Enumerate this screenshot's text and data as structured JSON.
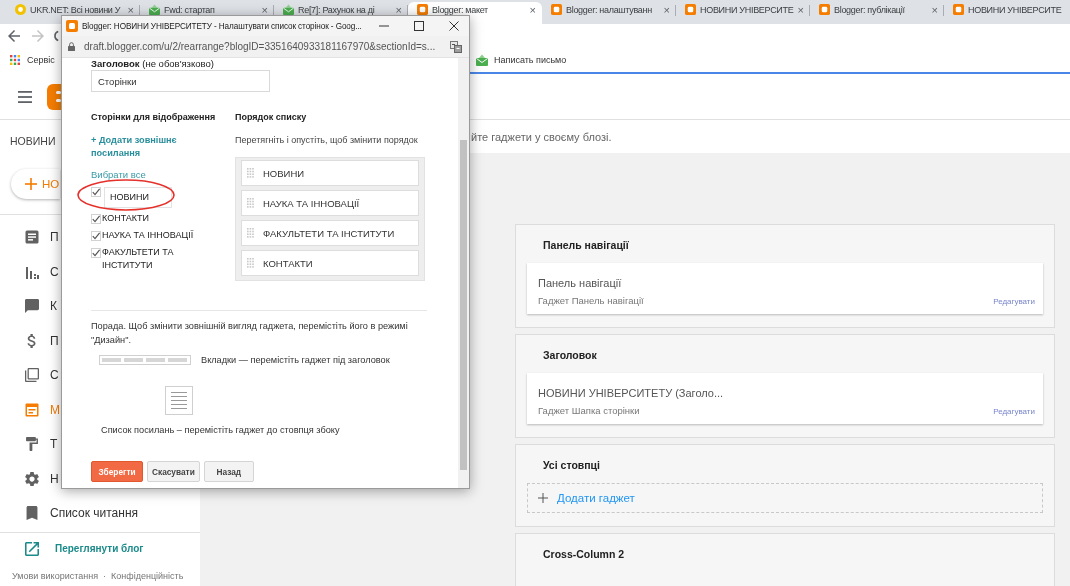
{
  "browser": {
    "tabs": [
      {
        "title": "UKR.NET: Всі новини У",
        "selected": false,
        "close": "×"
      },
      {
        "title": "Fwd: стартап",
        "selected": false,
        "close": "×"
      },
      {
        "title": "Re[7]: Рахунок на ді",
        "selected": false,
        "close": "×"
      },
      {
        "title": "Blogger: макет",
        "selected": true,
        "close": "×"
      },
      {
        "title": "Blogger: налаштуванн",
        "selected": false,
        "close": "×"
      },
      {
        "title": "НОВИНИ УНІВЕРСИТЕ",
        "selected": false,
        "close": "×"
      },
      {
        "title": "Blogger: публікації",
        "selected": false,
        "close": "×"
      },
      {
        "title": "НОВИНИ УНІВЕРСИТЕ",
        "selected": false
      }
    ],
    "nav_buttons": [
      {
        "kind": "back",
        "disabled": false
      },
      {
        "kind": "forward",
        "disabled": true
      },
      {
        "kind": "reload",
        "disabled": false
      }
    ],
    "bookmarks": [
      {
        "label": "Сервіс"
      },
      {
        "label": "Написать письмо"
      }
    ]
  },
  "popup": {
    "title": "Blogger: НОВИНИ УНІВЕРСИТЕТУ - Налаштувати список сторінок - Goog...",
    "url": "draft.blogger.com/u/2/rearrange?blogID=3351640933181167970&sectionId=s...",
    "title_label": "**Заголовок** (не обов'язково)",
    "title_value": "Сторінки",
    "pages_heading": "Сторінки для відображення",
    "add_link": "+ Додати зовнішнє посилання",
    "select_all": "Вибрати все",
    "pages": [
      {
        "label": "НОВИНИ",
        "checked": true,
        "focused": true,
        "circled": true
      },
      {
        "label": "КОНТАКТИ",
        "checked": true,
        "focused": false,
        "circled": false
      },
      {
        "label": "НАУКА ТА ІННОВАЦІЇ",
        "checked": true,
        "focused": false,
        "circled": false
      },
      {
        "label": "ФАКУЛЬТЕТИ ТА ІНСТИТУТИ",
        "checked": true,
        "focused": false,
        "circled": false
      }
    ],
    "order_heading": "Порядок списку",
    "order_hint": "Перетягніть і опустіть, щоб змінити порядок",
    "order": [
      "НОВИНИ",
      "НАУКА ТА ІННОВАЦІЇ",
      "ФАКУЛЬТЕТИ ТА ІНСТИТУТИ",
      "КОНТАКТИ"
    ],
    "tip": "Порада. Щоб змінити зовнішній вигляд гаджета, перемістіть його в режимі \"Дизайн\".",
    "tip_items": [
      {
        "kind": "tabs",
        "text": "Вкладки — перемістіть гаджет під заголовок"
      },
      {
        "kind": "list",
        "text": "Список посилань – перемістіть гаджет до стовпця збоку"
      }
    ],
    "buttons": [
      {
        "label": "Зберегти",
        "kind": "primary"
      },
      {
        "label": "Скасувати",
        "kind": "default"
      },
      {
        "label": "Назад",
        "kind": "default"
      }
    ]
  },
  "blogger": {
    "blog_title": "НОВИНИ",
    "new_post": "НО",
    "nav": [
      {
        "label": "П",
        "selected": false
      },
      {
        "label": "С",
        "selected": false
      },
      {
        "label": "К",
        "selected": false
      },
      {
        "label": "П",
        "selected": false
      },
      {
        "label": "С",
        "selected": false
      },
      {
        "label": "М",
        "selected": true
      },
      {
        "label": "Т",
        "selected": false
      },
      {
        "label": "Н",
        "selected": false
      },
      {
        "label": "Список читання",
        "selected": false
      }
    ],
    "view_blog": "Переглянути блог",
    "footer_links": [
      "Умови використання",
      "Конфіденційність"
    ],
    "footer_separator": "·",
    "description": "йте гаджети у своєму блозі.",
    "sections": [
      {
        "title": "Панель навігації",
        "gadgets": [
          {
            "title": "Панель навігації",
            "subtitle": "Гаджет Панель навігації",
            "action": "Редагувати"
          }
        ]
      },
      {
        "title": "Заголовок",
        "gadgets": [
          {
            "title": "НОВИНИ УНІВЕРСИТЕТУ (Заголо...",
            "subtitle": "Гаджет Шапка сторінки",
            "action": "Редагувати"
          }
        ]
      },
      {
        "title": "Усі стовпці",
        "add_gadget": "Додати гаджет"
      },
      {
        "title": "Cross-Column 2"
      }
    ]
  }
}
